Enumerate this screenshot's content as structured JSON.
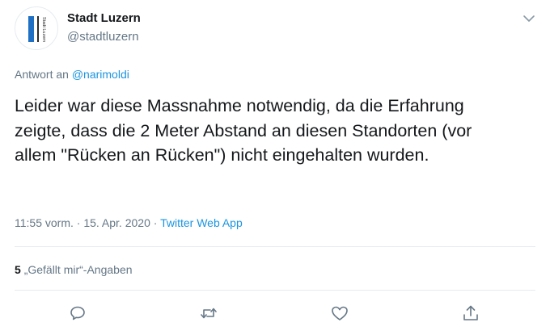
{
  "tweet": {
    "author": {
      "name": "Stadt Luzern",
      "handle": "@stadtluzern",
      "logo_text": "Stadt Luzern"
    },
    "reply_prefix": "Antwort an",
    "reply_mention": "@narimoldi",
    "text": "Leider war diese Massnahme notwendig, da die Erfahrung zeigte, dass die 2 Meter Abstand an diesen Standorten (vor allem \"Rücken an Rücken\") nicht eingehalten wurden.",
    "time": "11:55 vorm.",
    "separator": "·",
    "date": "15. Apr. 2020",
    "source": "Twitter Web App",
    "likes_count": "5",
    "likes_label": "„Gefällt mir“-Angaben",
    "actions": [
      "reply-icon",
      "retweet-icon",
      "like-icon",
      "share-icon"
    ],
    "colors": {
      "accent": "#1b95e0",
      "secondary_text": "#657786",
      "logo_blue": "#1f6fc5"
    }
  }
}
